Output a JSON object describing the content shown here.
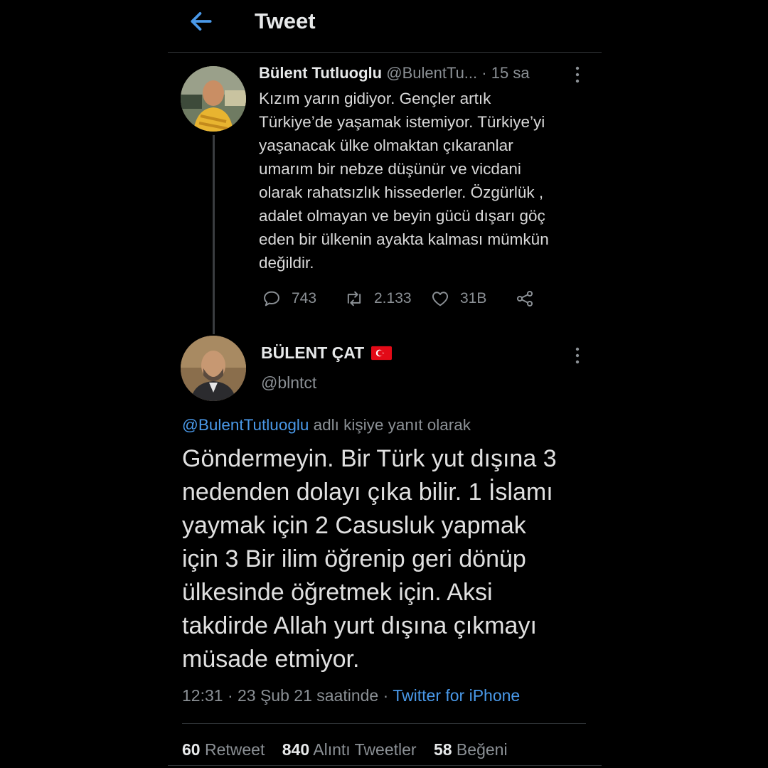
{
  "header": {
    "title": "Tweet"
  },
  "parent_tweet": {
    "name": "Bülent Tutluoglu",
    "handle": "@BulentTu...",
    "separator": "·",
    "time": "15 sa",
    "text": "Kızım yarın gidiyor. Gençler artık\nTürkiye’de yaşamak istemiyor. Türkiye’yi\nyaşanacak ülke olmaktan çıkaranlar\numarım bir nebze düşünür ve vicdani\nolarak rahatsızlık hissederler. Özgürlük ,\nadalet olmayan ve beyin gücü dışarı göç\neden bir ülkenin ayakta kalması mümkün\ndeğildir.",
    "replies": "743",
    "retweets": "2.133",
    "likes": "31B"
  },
  "reply_tweet": {
    "name": "BÜLENT ÇAT",
    "handle": "@blntct",
    "reply_to_handle": "@BulentTutluoglu",
    "reply_to_suffix": " adlı kişiye yanıt olarak",
    "text": "Göndermeyin. Bir Türk yut dışına 3\nnedenden dolayı çıka bilir. 1 İslamı\nyaymak için 2  Casusluk yapmak\niçin 3 Bir ilim öğrenip geri dönüp\nülkesinde öğretmek için. Aksi\ntakdirde Allah yurt dışına çıkmayı\nmüsade etmiyor.",
    "timestamp": "12:31 · 23 Şub 21 saatinde · ",
    "source": "Twitter for iPhone",
    "stats": {
      "retweet_count": "60",
      "retweet_label": " Retweet",
      "quote_count": "840",
      "quote_label": " Alıntı Tweetler",
      "like_count": "58",
      "like_label": " Beğeni"
    }
  },
  "icons": {
    "back": "arrow-left-icon",
    "more": "vertical-dots-icon",
    "reply": "speech-bubble-icon",
    "retweet": "retweet-icon",
    "like": "heart-icon",
    "share": "share-icon",
    "flag": "turkey-flag-icon"
  },
  "colors": {
    "background": "#000000",
    "accent": "#4a99e9",
    "flag_red": "#e30a17",
    "muted": "#8b9095"
  }
}
